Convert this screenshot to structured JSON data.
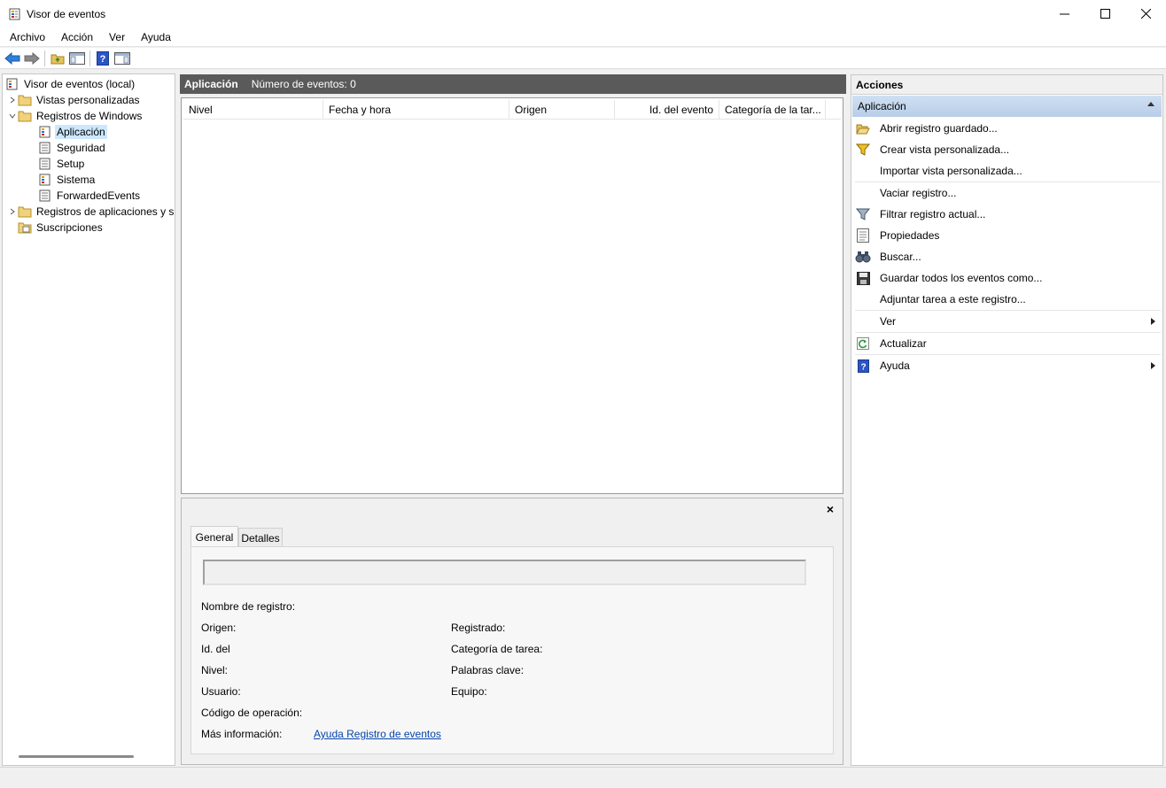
{
  "window": {
    "title": "Visor de eventos"
  },
  "menu": [
    "Archivo",
    "Acción",
    "Ver",
    "Ayuda"
  ],
  "tree": {
    "root": "Visor de eventos (local)",
    "items": [
      {
        "label": "Vistas personalizadas",
        "level": 1,
        "expander": "collapsed",
        "icon": "folder-icon"
      },
      {
        "label": "Registros de Windows",
        "level": 1,
        "expander": "expanded",
        "icon": "folder-icon"
      },
      {
        "label": "Aplicación",
        "level": 2,
        "expander": "none",
        "icon": "log-icon",
        "selected": true
      },
      {
        "label": "Seguridad",
        "level": 2,
        "expander": "none",
        "icon": "log-icon"
      },
      {
        "label": "Setup",
        "level": 2,
        "expander": "none",
        "icon": "log-icon"
      },
      {
        "label": "Sistema",
        "level": 2,
        "expander": "none",
        "icon": "log-icon"
      },
      {
        "label": "ForwardedEvents",
        "level": 2,
        "expander": "none",
        "icon": "log-icon"
      },
      {
        "label": "Registros de aplicaciones y s",
        "level": 1,
        "expander": "collapsed",
        "icon": "folder-icon"
      },
      {
        "label": "Suscripciones",
        "level": 1,
        "expander": "none",
        "icon": "subscription-icon"
      }
    ]
  },
  "center": {
    "title": "Aplicación",
    "count_text": "Número de eventos: 0",
    "columns": [
      "Nivel",
      "Fecha y hora",
      "Origen",
      "Id. del evento",
      "Categoría de la tar..."
    ]
  },
  "detail": {
    "close": "×",
    "tabs": [
      "General",
      "Detalles"
    ],
    "fields": {
      "log_name": "Nombre de registro:",
      "source": "Origen:",
      "event_id": "Id. del",
      "level": "Nivel:",
      "user": "Usuario:",
      "opcode": "Código de operación:",
      "more_info": "Más información:",
      "more_info_link": "Ayuda Registro de eventos",
      "logged": "Registrado:",
      "task_category": "Categoría de tarea:",
      "keywords": "Palabras clave:",
      "computer": "Equipo:"
    }
  },
  "actions": {
    "header": "Acciones",
    "section": "Aplicación",
    "items": [
      {
        "label": "Abrir registro guardado...",
        "icon": "open-folder-icon",
        "submenu": false
      },
      {
        "label": "Crear vista personalizada...",
        "icon": "filter-add-icon",
        "submenu": false
      },
      {
        "label": "Importar vista personalizada...",
        "icon": "",
        "submenu": false
      },
      {
        "label": "Vaciar registro...",
        "icon": "",
        "submenu": false
      },
      {
        "label": "Filtrar registro actual...",
        "icon": "filter-icon",
        "submenu": false
      },
      {
        "label": "Propiedades",
        "icon": "properties-icon",
        "submenu": false
      },
      {
        "label": "Buscar...",
        "icon": "binoculars-icon",
        "submenu": false
      },
      {
        "label": "Guardar todos los eventos como...",
        "icon": "save-icon",
        "submenu": false
      },
      {
        "label": "Adjuntar tarea a este registro...",
        "icon": "",
        "submenu": false
      },
      {
        "label": "Ver",
        "icon": "",
        "submenu": true
      },
      {
        "label": "Actualizar",
        "icon": "refresh-icon",
        "submenu": false
      },
      {
        "label": "Ayuda",
        "icon": "help-icon",
        "submenu": true
      }
    ]
  }
}
